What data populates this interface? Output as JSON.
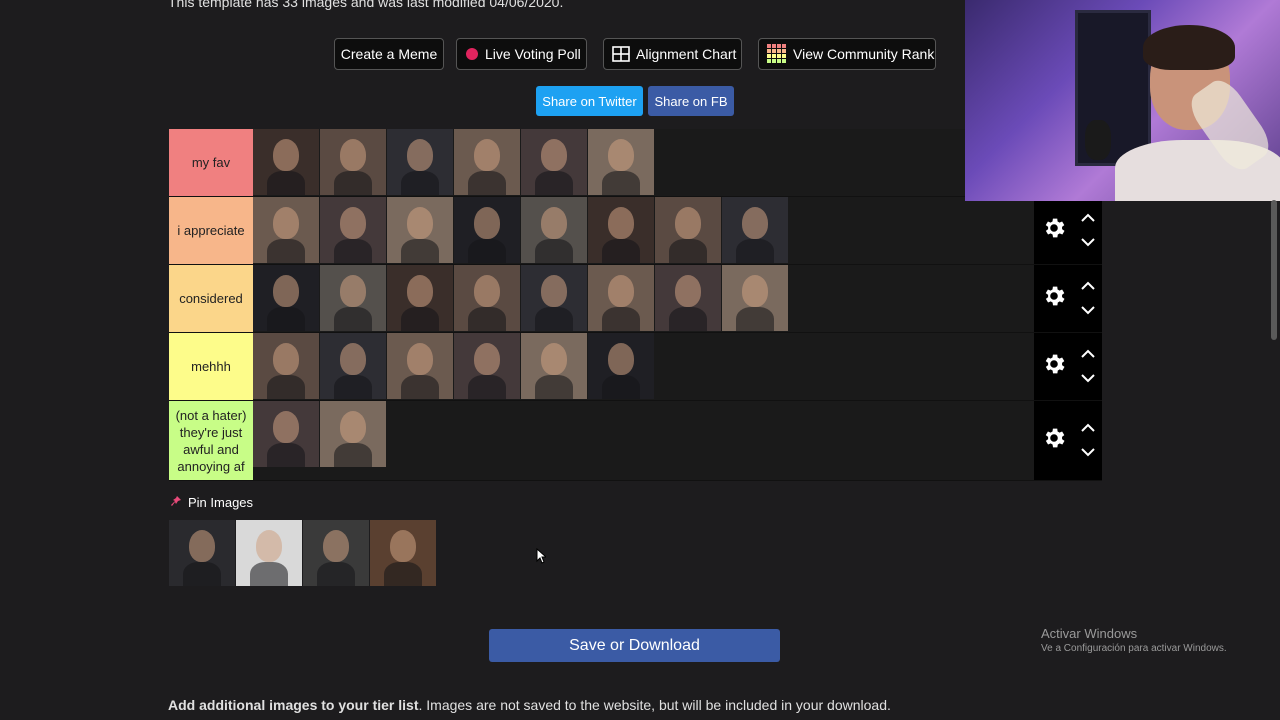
{
  "template_info": "This template has 33 images and was last modified 04/06/2020.",
  "toolbar": {
    "create_meme": "Create a Meme",
    "live_poll": "Live Voting Poll",
    "alignment_chart": "Alignment Chart",
    "community_rank": "View Community Rank"
  },
  "share": {
    "twitter": "Share on Twitter",
    "facebook": "Share on FB",
    "twitter_color": "#1da1f2",
    "facebook_color": "#3b5ba5"
  },
  "tiers": [
    {
      "label": "my fav",
      "color": "#f08080",
      "count": 6
    },
    {
      "label": "i appreciate",
      "color": "#f7b68a",
      "count": 8
    },
    {
      "label": "considered",
      "color": "#fbd68a",
      "count": 8
    },
    {
      "label": "mehhh",
      "color": "#fdfc8a",
      "count": 6
    },
    {
      "label": "(not a hater) they're just awful and annoying af",
      "color": "#c8fd87",
      "count": 2
    }
  ],
  "pin": {
    "label": "Pin Images",
    "count": 4
  },
  "save_button": "Save or Download",
  "activate_windows": {
    "line1": "Activar Windows",
    "line2": "Ve a Configuración para activar Windows."
  },
  "footer": {
    "bold": "Add additional images to your tier list",
    "rest": ". Images are not saved to the website, but will be included in your download."
  }
}
